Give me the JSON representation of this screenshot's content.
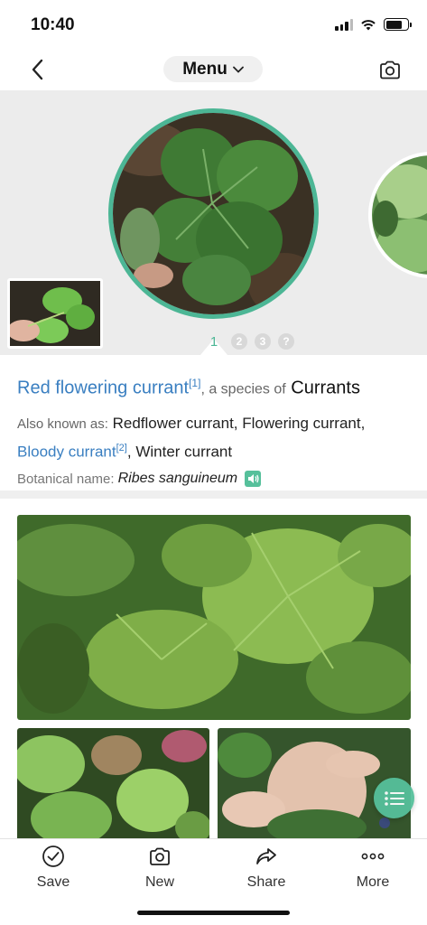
{
  "status_bar": {
    "time": "10:40"
  },
  "nav": {
    "menu_label": "Menu"
  },
  "gallery": {
    "pager": {
      "active": "1",
      "dots": [
        "2",
        "3",
        "?"
      ]
    }
  },
  "info": {
    "common_name": "Red flowering currant",
    "common_name_ref": "[1]",
    "species_connector": ", a species of",
    "group": "Currants",
    "aka_label": "Also known as:",
    "aka_1": "Redflower currant",
    "aka_sep1": ",",
    "aka_2": "Flowering currant",
    "aka_sep2": ",",
    "aka_3": "Bloody currant",
    "aka_3_ref": "[2]",
    "aka_sep3": ",",
    "aka_4": "Winter currant",
    "botanical_label": "Botanical name:",
    "botanical_name": "Ribes sanguineum"
  },
  "tabs": [
    {
      "label": "Save",
      "icon": "check-circle-icon"
    },
    {
      "label": "New",
      "icon": "camera-icon"
    },
    {
      "label": "Share",
      "icon": "share-arrow-icon"
    },
    {
      "label": "More",
      "icon": "more-dots-icon"
    }
  ],
  "colors": {
    "accent": "#4cb695",
    "link": "#3a7fc1"
  }
}
